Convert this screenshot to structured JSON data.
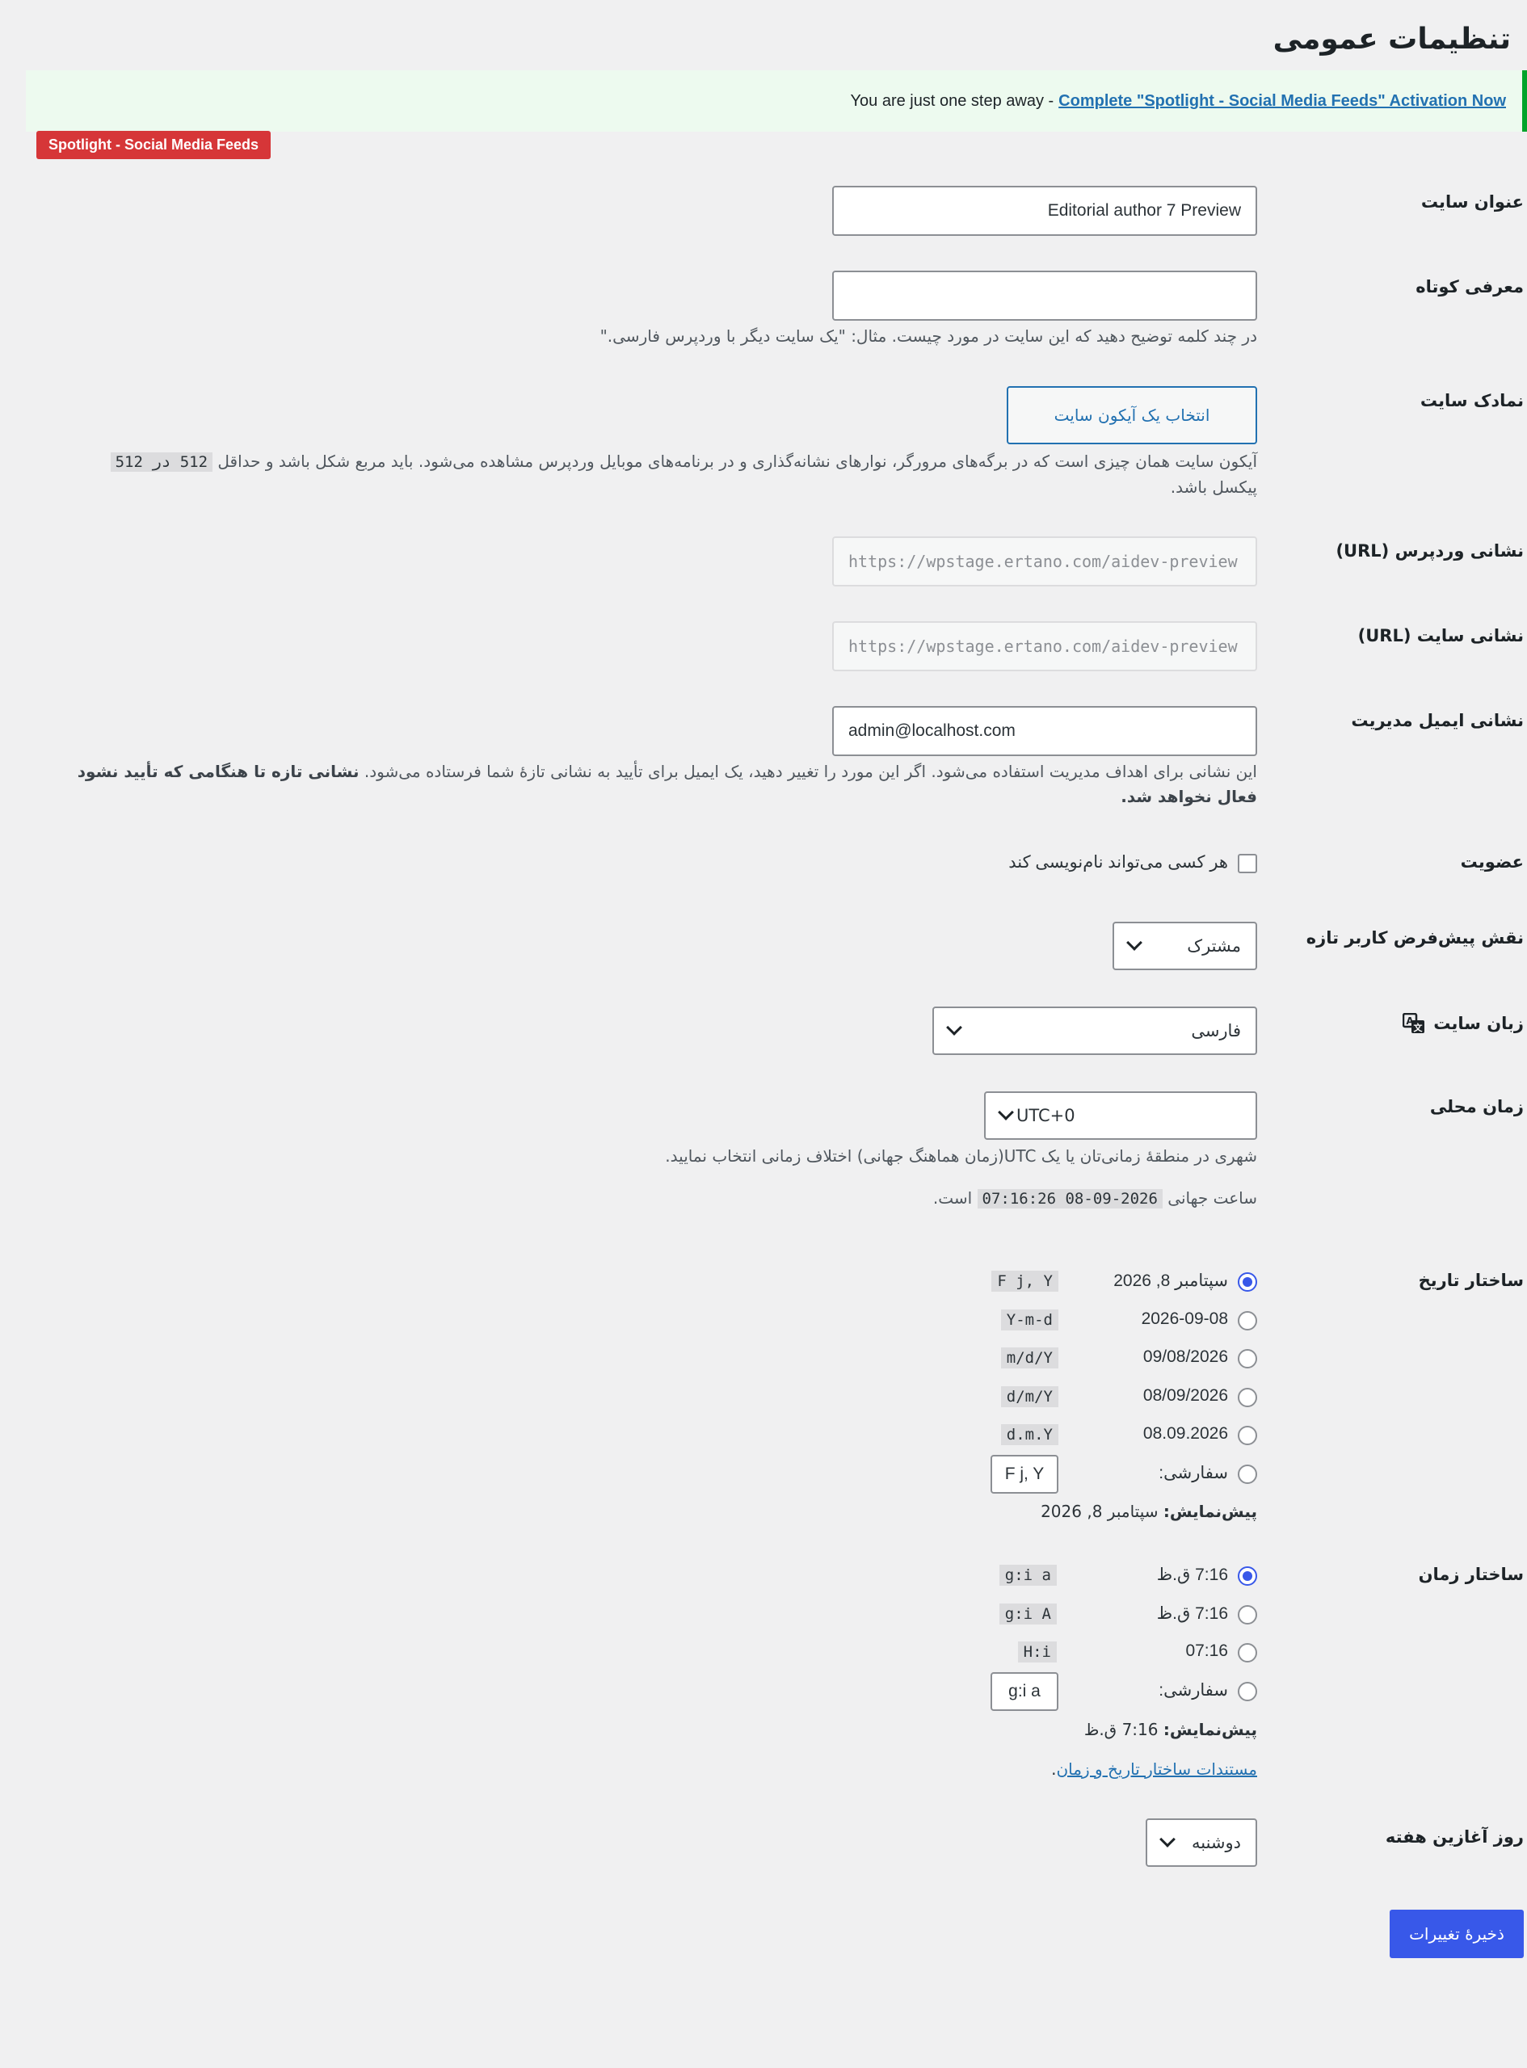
{
  "page": {
    "title": "تنظیمات عمومی"
  },
  "notice": {
    "text": "You are just one step away - ",
    "link": "Complete \"Spotlight - Social Media Feeds\" Activation Now",
    "badge": "Spotlight - Social Media Feeds"
  },
  "fields": {
    "site_title": {
      "label": "عنوان سایت",
      "value": "Editorial author 7 Preview"
    },
    "tagline": {
      "label": "معرفی کوتاه",
      "value": "",
      "desc": "در چند کلمه توضیح دهید که این سایت در مورد چیست. مثال: \"یک سایت دیگر با وردپرس فارسی.\""
    },
    "site_icon": {
      "label": "نمادک سایت",
      "button": "انتخاب یک آیکون سایت",
      "desc_a": "آیکون سایت همان چیزی است که در برگه‌های مرورگر، نوارهای نشانه‌گذاری و در برنامه‌های موبایل وردپرس مشاهده می‌شود. باید مربع شکل باشد و حداقل",
      "desc_code": "512 در 512",
      "desc_b": "پیکسل باشد."
    },
    "wp_url": {
      "label": "نشانی وردپرس (URL)",
      "value": "https://wpstage.ertano.com/aidev-preview"
    },
    "site_url": {
      "label": "نشانی سایت (URL)",
      "value": "https://wpstage.ertano.com/aidev-preview"
    },
    "admin_email": {
      "label": "نشانی ایمیل مدیریت",
      "value": "admin@localhost.com",
      "desc": "این نشانی برای اهداف مدیریت استفاده می‌شود. اگر این مورد را تغییر دهید، یک ایمیل برای تأیید به نشانی تازهٔ شما فرستاده می‌شود.",
      "desc_bold": "نشانی تازه تا هنگامی که تأیید نشود فعال نخواهد شد."
    },
    "membership": {
      "label": "عضویت",
      "checkbox_label": "هر کسی می‌تواند نام‌نویسی کند",
      "checked": false
    },
    "default_role": {
      "label": "نقش پیش‌فرض کاربر تازه",
      "value": "مشترک"
    },
    "site_language": {
      "label": "زبان سایت",
      "value": "فارسی"
    },
    "timezone": {
      "label": "زمان محلی",
      "value": "UTC+0",
      "desc": "شهری در منطقهٔ زمانی‌تان یا یک UTC(زمان هماهنگ جهانی) اختلاف زمانی انتخاب نمایید.",
      "utc_prefix": "ساعت جهانی",
      "utc_time": "2026-09-08 07:16:26",
      "utc_suffix": "است."
    },
    "date_format": {
      "label": "ساختار تاریخ",
      "options": [
        {
          "text": "سپتامبر 8, 2026",
          "code": "F j, Y",
          "checked": true
        },
        {
          "text": "2026-09-08",
          "code": "Y-m-d",
          "checked": false
        },
        {
          "text": "09/08/2026",
          "code": "m/d/Y",
          "checked": false
        },
        {
          "text": "08/09/2026",
          "code": "d/m/Y",
          "checked": false
        },
        {
          "text": "08.09.2026",
          "code": "d.m.Y",
          "checked": false
        }
      ],
      "custom_label": "سفارشی:",
      "custom_value": "F j, Y",
      "preview_label": "پیش‌نمایش:",
      "preview_value": "سپتامبر 8, 2026"
    },
    "time_format": {
      "label": "ساختار زمان",
      "options": [
        {
          "text": "7:16 ق.ظ",
          "code": "g:i a",
          "checked": true
        },
        {
          "text": "7:16 ق.ظ",
          "code": "g:i A",
          "checked": false
        },
        {
          "text": "07:16",
          "code": "H:i",
          "checked": false
        }
      ],
      "custom_label": "سفارشی:",
      "custom_value": "g:i a",
      "preview_label": "پیش‌نمایش:",
      "preview_value": "7:16 ق.ظ",
      "doc_link": "مستندات ساختار تاریخ و زمان",
      "doc_suffix": "."
    },
    "week_start": {
      "label": "روز آغازین هفته",
      "value": "دوشنبه"
    }
  },
  "save_button": "ذخیرهٔ تغییرات"
}
